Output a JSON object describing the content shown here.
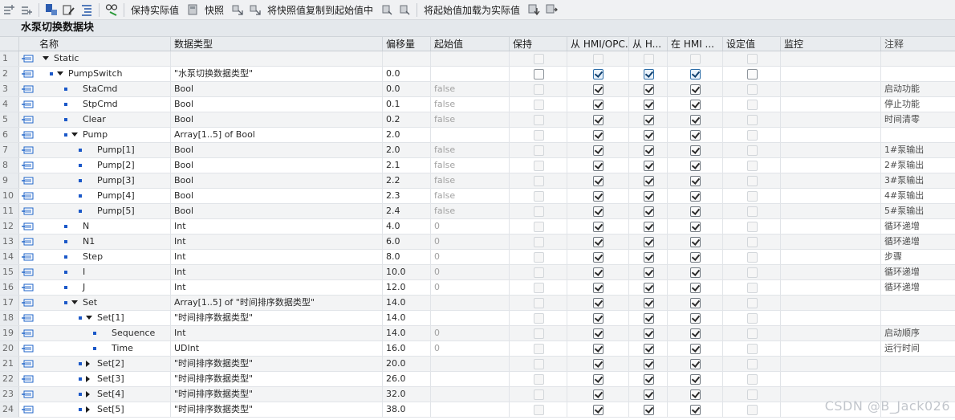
{
  "toolbar": {
    "keep_actual_label": "保持实际值",
    "snapshot_label": "快照",
    "copy_snapshot_label": "将快照值复制到起始值中",
    "load_start_label": "将起始值加载为实际值"
  },
  "block_title": "水泵切换数据块",
  "columns": {
    "name": "名称",
    "type": "数据类型",
    "offset": "偏移量",
    "start": "起始值",
    "retain": "保持",
    "hmi_opc": "从 HMI/OPC..",
    "hmi_h": "从 H...",
    "in_hmi": "在 HMI ...",
    "setpoint": "设定值",
    "monitor": "监控",
    "comment": "注释"
  },
  "rows": [
    {
      "num": "1",
      "name": "Static",
      "type": "",
      "offset": "",
      "start": "",
      "comment": ""
    },
    {
      "num": "2",
      "name": "PumpSwitch",
      "type": "\"水泵切换数据类型\"",
      "offset": "0.0",
      "start": "",
      "comment": ""
    },
    {
      "num": "3",
      "name": "StaCmd",
      "type": "Bool",
      "offset": "0.0",
      "start": "false",
      "comment": "启动功能"
    },
    {
      "num": "4",
      "name": "StpCmd",
      "type": "Bool",
      "offset": "0.1",
      "start": "false",
      "comment": "停止功能"
    },
    {
      "num": "5",
      "name": "Clear",
      "type": "Bool",
      "offset": "0.2",
      "start": "false",
      "comment": "时间清零"
    },
    {
      "num": "6",
      "name": "Pump",
      "type": "Array[1..5] of Bool",
      "offset": "2.0",
      "start": "",
      "comment": ""
    },
    {
      "num": "7",
      "name": "Pump[1]",
      "type": "Bool",
      "offset": "2.0",
      "start": "false",
      "comment": "1#泵输出"
    },
    {
      "num": "8",
      "name": "Pump[2]",
      "type": "Bool",
      "offset": "2.1",
      "start": "false",
      "comment": "2#泵输出"
    },
    {
      "num": "9",
      "name": "Pump[3]",
      "type": "Bool",
      "offset": "2.2",
      "start": "false",
      "comment": "3#泵输出"
    },
    {
      "num": "10",
      "name": "Pump[4]",
      "type": "Bool",
      "offset": "2.3",
      "start": "false",
      "comment": "4#泵输出"
    },
    {
      "num": "11",
      "name": "Pump[5]",
      "type": "Bool",
      "offset": "2.4",
      "start": "false",
      "comment": "5#泵输出"
    },
    {
      "num": "12",
      "name": "N",
      "type": "Int",
      "offset": "4.0",
      "start": "0",
      "comment": "循环递增"
    },
    {
      "num": "13",
      "name": "N1",
      "type": "Int",
      "offset": "6.0",
      "start": "0",
      "comment": "循环递增"
    },
    {
      "num": "14",
      "name": "Step",
      "type": "Int",
      "offset": "8.0",
      "start": "0",
      "comment": "步骤"
    },
    {
      "num": "15",
      "name": "I",
      "type": "Int",
      "offset": "10.0",
      "start": "0",
      "comment": "循环递增"
    },
    {
      "num": "16",
      "name": "J",
      "type": "Int",
      "offset": "12.0",
      "start": "0",
      "comment": "循环递增"
    },
    {
      "num": "17",
      "name": "Set",
      "type": "Array[1..5] of \"时间排序数据类型\"",
      "offset": "14.0",
      "start": "",
      "comment": ""
    },
    {
      "num": "18",
      "name": "Set[1]",
      "type": "\"时间排序数据类型\"",
      "offset": "14.0",
      "start": "",
      "comment": ""
    },
    {
      "num": "19",
      "name": "Sequence",
      "type": "Int",
      "offset": "14.0",
      "start": "0",
      "comment": "启动顺序"
    },
    {
      "num": "20",
      "name": "Time",
      "type": "UDInt",
      "offset": "16.0",
      "start": "0",
      "comment": "运行时间"
    },
    {
      "num": "21",
      "name": "Set[2]",
      "type": "\"时间排序数据类型\"",
      "offset": "20.0",
      "start": "",
      "comment": ""
    },
    {
      "num": "22",
      "name": "Set[3]",
      "type": "\"时间排序数据类型\"",
      "offset": "26.0",
      "start": "",
      "comment": ""
    },
    {
      "num": "23",
      "name": "Set[4]",
      "type": "\"时间排序数据类型\"",
      "offset": "32.0",
      "start": "",
      "comment": ""
    },
    {
      "num": "24",
      "name": "Set[5]",
      "type": "\"时间排序数据类型\"",
      "offset": "38.0",
      "start": "",
      "comment": ""
    }
  ],
  "watermark": "CSDN @B_Jack026"
}
